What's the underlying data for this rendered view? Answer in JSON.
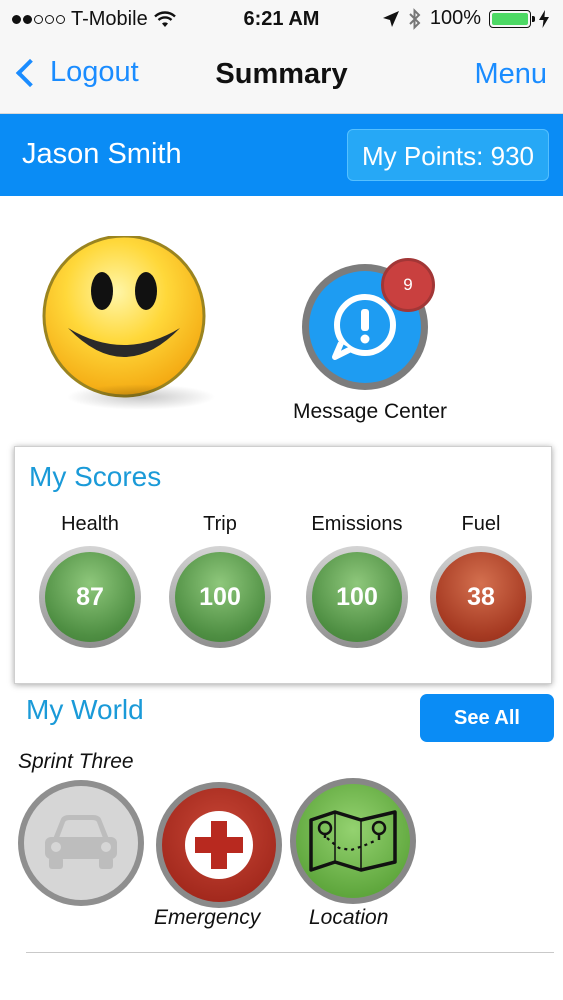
{
  "status_bar": {
    "carrier": "T-Mobile",
    "time": "6:21 AM",
    "battery": "100%"
  },
  "nav": {
    "back_label": "Logout",
    "title": "Summary",
    "menu_label": "Menu"
  },
  "user": {
    "name": "Jason Smith",
    "points_label": "My Points: 930"
  },
  "message_center": {
    "badge_count": "9",
    "label": "Message Center"
  },
  "scores": {
    "title": "My Scores",
    "items": [
      {
        "label": "Health",
        "value": "87",
        "color": "#5a9a4c"
      },
      {
        "label": "Trip",
        "value": "100",
        "color": "#5a9a4c"
      },
      {
        "label": "Emissions",
        "value": "100",
        "color": "#5a9a4c"
      },
      {
        "label": "Fuel",
        "value": "38",
        "color": "#a63a22"
      }
    ]
  },
  "world": {
    "title": "My World",
    "see_all_label": "See All",
    "items": [
      {
        "label": "Sprint  Three",
        "icon": "car-icon"
      },
      {
        "label": "Emergency",
        "icon": "medical-cross-icon"
      },
      {
        "label": "Location",
        "icon": "map-icon"
      }
    ]
  },
  "colors": {
    "accent": "#0a8cf5",
    "link": "#1a8cff",
    "section_title": "#1a9ad8"
  }
}
